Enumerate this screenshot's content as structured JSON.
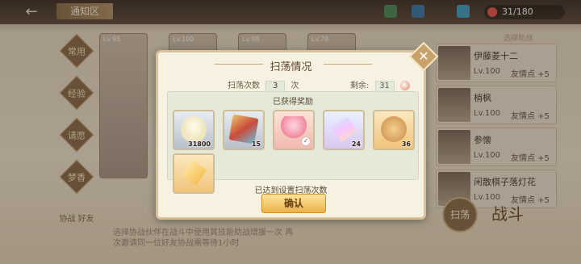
{
  "header": {
    "back_glyph": "←",
    "title": "通知区",
    "currency_value": "31/180"
  },
  "side_nav": [
    "常用",
    "经验",
    "请愿",
    "梦香"
  ],
  "side_nav_bottom": "协战\n好友",
  "hero_cards": [
    {
      "level": "Lv.95"
    },
    {
      "level": "Lv.100"
    },
    {
      "level": "Lv.98"
    },
    {
      "level": "Lv.78"
    }
  ],
  "bottom_hint": "选择协战伙伴在战斗中使用其技能助战增援一次\n再次邀请同一位好友协战需等待1小时",
  "friends_panel": {
    "title": "选择助战",
    "friends": [
      {
        "name": "伊藤菱十二",
        "level": "Lv.100",
        "points": "友情点 +5"
      },
      {
        "name": "梢枫",
        "level": "Lv.100",
        "points": "友情点 +5"
      },
      {
        "name": "参懐",
        "level": "Lv.100",
        "points": "友情点 +5"
      },
      {
        "name": "闲散棋子落灯花",
        "level": "Lv.100",
        "points": "友情点 +5"
      }
    ]
  },
  "sweep_button": "扫荡",
  "battle_button": "战斗",
  "modal": {
    "title": "扫荡情况",
    "close_glyph": "✕",
    "sweep_count_label": "扫荡次数",
    "sweep_count_value": "3",
    "sweep_count_unit": "次",
    "remaining_label": "剩余:",
    "remaining_value": "31",
    "rewards_title": "已获得奖励",
    "items": [
      {
        "icon": "shell-coin-icon",
        "qty": "31800",
        "bg": "bg-grey",
        "art": "shell"
      },
      {
        "icon": "silk-cloth-icon",
        "qty": "15",
        "bg": "bg-grey",
        "art": "cloth"
      },
      {
        "icon": "fairy-card-icon",
        "qty": "",
        "bg": "bg-pink",
        "art": "fairy",
        "check": "✓"
      },
      {
        "icon": "rainbow-crystal-icon",
        "qty": "24",
        "bg": "bg-rainbow",
        "art": "crystal"
      },
      {
        "icon": "cookie-icon",
        "qty": "36",
        "bg": "bg-gold",
        "art": "cookie"
      },
      {
        "icon": "gold-gem-icon",
        "qty": "",
        "bg": "bg-gold",
        "art": "gem"
      }
    ],
    "done_text": "已达到设置扫荡次数",
    "confirm_label": "确认"
  }
}
